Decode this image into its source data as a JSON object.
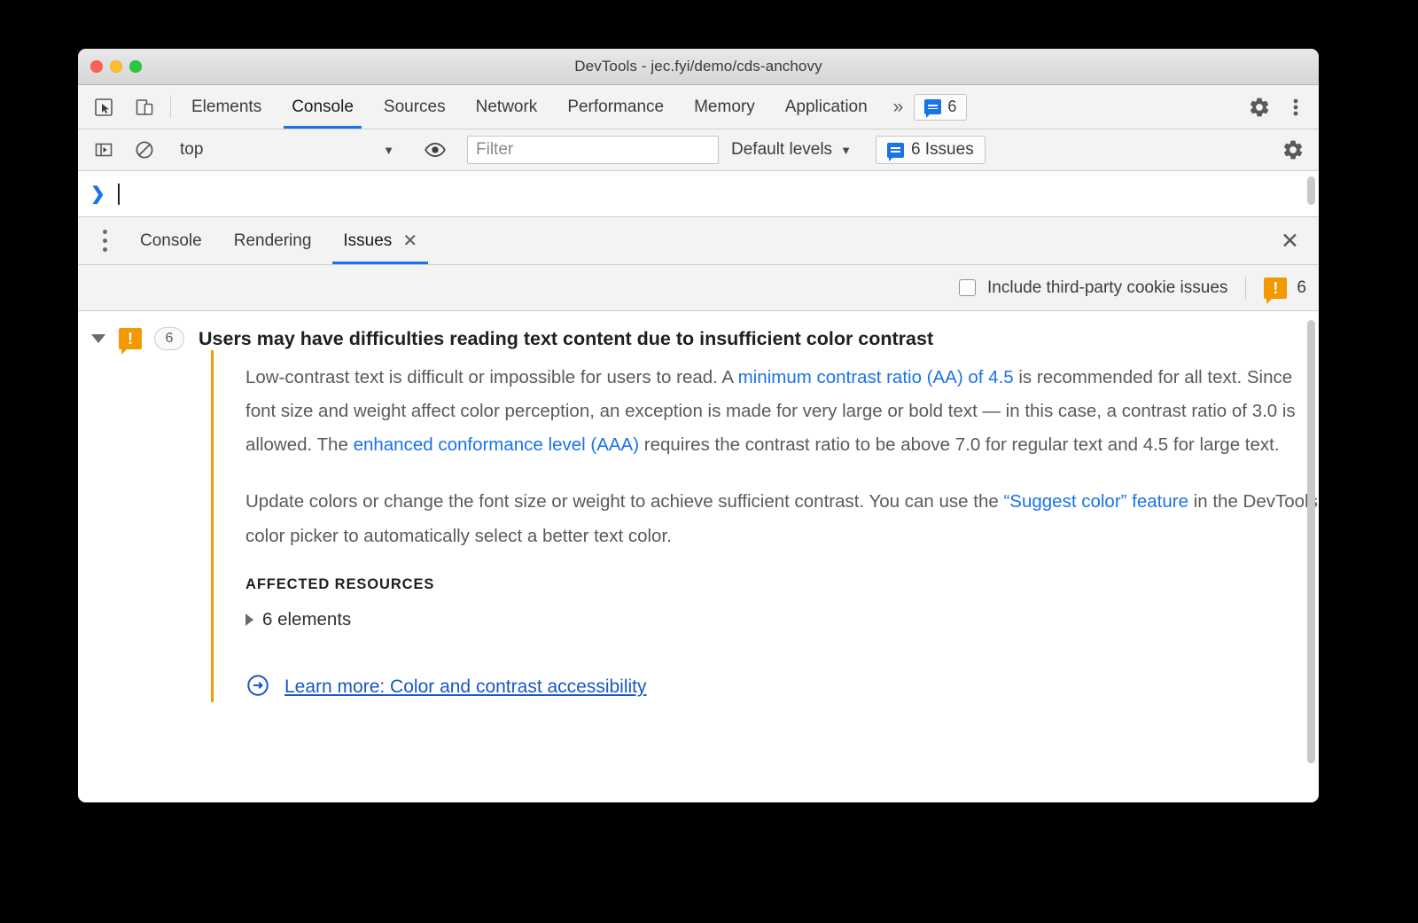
{
  "window": {
    "title": "DevTools - jec.fyi/demo/cds-anchovy",
    "traffic_lights": [
      "close",
      "minimize",
      "zoom"
    ]
  },
  "main_tabbar": {
    "left_icons": [
      "inspect-element-icon",
      "device-toolbar-icon"
    ],
    "tabs": [
      {
        "label": "Elements",
        "active": false
      },
      {
        "label": "Console",
        "active": true
      },
      {
        "label": "Sources",
        "active": false
      },
      {
        "label": "Network",
        "active": false
      },
      {
        "label": "Performance",
        "active": false
      },
      {
        "label": "Memory",
        "active": false
      },
      {
        "label": "Application",
        "active": false
      }
    ],
    "more_tabs_glyph": "»",
    "issues_badge": {
      "icon": "issues-bubble-icon",
      "count": "6"
    },
    "settings_icon": "gear-icon",
    "more_icon": "vertical-dots-icon"
  },
  "console_toolbar": {
    "sidebar_toggle_icon": "console-sidebar-icon",
    "clear_icon": "clear-console-icon",
    "context": {
      "value": "top",
      "caret": "▼"
    },
    "eye_icon": "live-expression-eye-icon",
    "filter": {
      "placeholder": "Filter",
      "value": ""
    },
    "levels": {
      "label": "Default levels",
      "caret": "▼"
    },
    "issues_button": {
      "icon": "issues-bubble-icon",
      "label": "6 Issues"
    },
    "settings_icon": "gear-icon"
  },
  "console_prompt": {
    "chevron": "❯",
    "value": ""
  },
  "drawer": {
    "menu_icon": "vertical-dots-icon",
    "tabs": [
      {
        "label": "Console",
        "active": false,
        "closable": false
      },
      {
        "label": "Rendering",
        "active": false,
        "closable": false
      },
      {
        "label": "Issues",
        "active": true,
        "closable": true,
        "close_glyph": "✕"
      }
    ],
    "close_glyph": "✕"
  },
  "issues_filter_row": {
    "checkbox": {
      "label": "Include third-party cookie issues",
      "checked": false
    },
    "warning_icon": "warning-bubble-icon",
    "warning_count": "6"
  },
  "issue": {
    "expanded": true,
    "icon": "warning-bubble-icon",
    "count": "6",
    "title": "Users may have difficulties reading text content due to insufficient color contrast",
    "paragraph1": {
      "part1": "Low-contrast text is difficult or impossible for users to read. A ",
      "link1": "minimum contrast ratio (AA) of 4.5",
      "part2": " is recommended for all text. Since font size and weight affect color perception, an exception is made for very large or bold text — in this case, a contrast ratio of 3.0 is allowed. The ",
      "link2": "enhanced conformance level (AAA)",
      "part3": " requires the contrast ratio to be above 7.0 for regular text and 4.5 for large text."
    },
    "paragraph2": {
      "part1": "Update colors or change the font size or weight to achieve sufficient contrast. You can use the ",
      "link1": "“Suggest color” feature",
      "part2": " in the DevTools color picker to automatically select a better text color."
    },
    "affected_resources_header": "AFFECTED RESOURCES",
    "affected_resource": {
      "label": "6 elements",
      "expanded": false
    },
    "learn_more": {
      "icon": "arrow-circle-icon",
      "label": "Learn more: Color and contrast accessibility"
    }
  },
  "colors": {
    "accent_blue": "#1a73e8",
    "warning_orange": "#f29900",
    "link_blue": "#1a56c4",
    "toolbar_bg": "#f3f3f3"
  }
}
